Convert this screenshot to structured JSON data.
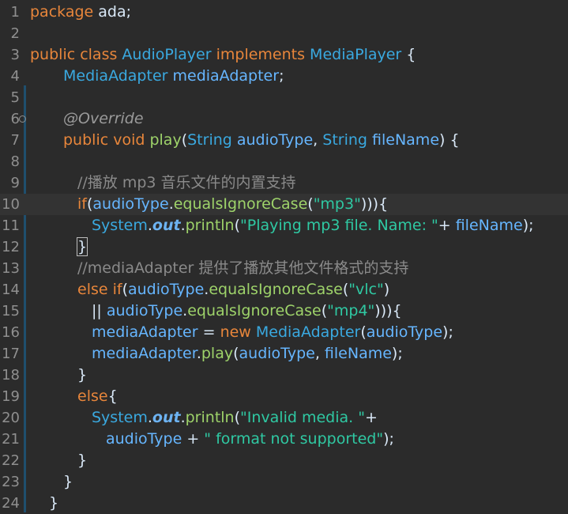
{
  "editor": {
    "current_line": 10,
    "lines": [
      {
        "n": "1",
        "indent": 0,
        "tokens": [
          [
            "kw",
            "package"
          ],
          [
            "pln",
            " ada;"
          ]
        ]
      },
      {
        "n": "2",
        "indent": 0,
        "tokens": []
      },
      {
        "n": "3",
        "indent": 0,
        "tokens": [
          [
            "kw",
            "public class "
          ],
          [
            "type",
            "AudioPlayer"
          ],
          [
            "kw",
            " implements "
          ],
          [
            "type",
            "MediaPlayer"
          ],
          [
            "pln",
            " {"
          ]
        ]
      },
      {
        "n": "4",
        "indent": 42,
        "tokens": [
          [
            "type",
            "MediaAdapter"
          ],
          [
            "pln",
            " "
          ],
          [
            "fld",
            "mediaAdapter"
          ],
          [
            "pln",
            ";"
          ]
        ]
      },
      {
        "n": "5",
        "indent": 0,
        "tokens": []
      },
      {
        "n": "6",
        "indent": 42,
        "tokens": [
          [
            "ann",
            "@Override"
          ]
        ]
      },
      {
        "n": "7",
        "indent": 42,
        "tokens": [
          [
            "kw",
            "public void "
          ],
          [
            "mth",
            "play"
          ],
          [
            "pln",
            "("
          ],
          [
            "type",
            "String"
          ],
          [
            "pln",
            " "
          ],
          [
            "fld",
            "audioType"
          ],
          [
            "pln",
            ", "
          ],
          [
            "type",
            "String"
          ],
          [
            "pln",
            " "
          ],
          [
            "fld",
            "fileName"
          ],
          [
            "pln",
            ") {"
          ]
        ]
      },
      {
        "n": "8",
        "indent": 0,
        "tokens": []
      },
      {
        "n": "9",
        "indent": 60,
        "tokens": [
          [
            "cmt",
            "//播放 mp3 音乐文件的内置支持"
          ]
        ]
      },
      {
        "n": "10",
        "indent": 60,
        "tokens": [
          [
            "kw",
            "if"
          ],
          [
            "pln",
            "("
          ],
          [
            "fld",
            "audioType"
          ],
          [
            "pln",
            "."
          ],
          [
            "mth",
            "equalsIgnoreCase"
          ],
          [
            "pln",
            "("
          ],
          [
            "str",
            "\"mp3\""
          ],
          [
            "pln",
            "))){"
          ]
        ]
      },
      {
        "n": "11",
        "indent": 78,
        "tokens": [
          [
            "type",
            "System"
          ],
          [
            "pln",
            "."
          ],
          [
            "sfield",
            "out"
          ],
          [
            "pln",
            "."
          ],
          [
            "mth",
            "println"
          ],
          [
            "pln",
            "("
          ],
          [
            "str",
            "\"Playing mp3 file. Name: \""
          ],
          [
            "pln",
            "+ "
          ],
          [
            "fld",
            "fileName"
          ],
          [
            "pln",
            ");"
          ]
        ]
      },
      {
        "n": "12",
        "indent": 60,
        "tokens": [
          [
            "brace",
            "}"
          ]
        ]
      },
      {
        "n": "13",
        "indent": 60,
        "tokens": [
          [
            "cmt",
            "//mediaAdapter 提供了播放其他文件格式的支持"
          ]
        ]
      },
      {
        "n": "14",
        "indent": 60,
        "tokens": [
          [
            "kw",
            "else if"
          ],
          [
            "pln",
            "("
          ],
          [
            "fld",
            "audioType"
          ],
          [
            "pln",
            "."
          ],
          [
            "mth",
            "equalsIgnoreCase"
          ],
          [
            "pln",
            "("
          ],
          [
            "str",
            "\"vlc\""
          ],
          [
            "pln",
            ")"
          ]
        ]
      },
      {
        "n": "15",
        "indent": 78,
        "tokens": [
          [
            "pln",
            "|| "
          ],
          [
            "fld",
            "audioType"
          ],
          [
            "pln",
            "."
          ],
          [
            "mth",
            "equalsIgnoreCase"
          ],
          [
            "pln",
            "("
          ],
          [
            "str",
            "\"mp4\""
          ],
          [
            "pln",
            "))){"
          ]
        ]
      },
      {
        "n": "16",
        "indent": 78,
        "tokens": [
          [
            "fld",
            "mediaAdapter"
          ],
          [
            "pln",
            " = "
          ],
          [
            "kw",
            "new "
          ],
          [
            "type",
            "MediaAdapter"
          ],
          [
            "pln",
            "("
          ],
          [
            "fld",
            "audioType"
          ],
          [
            "pln",
            ");"
          ]
        ]
      },
      {
        "n": "17",
        "indent": 78,
        "tokens": [
          [
            "fld",
            "mediaAdapter"
          ],
          [
            "pln",
            "."
          ],
          [
            "mth",
            "play"
          ],
          [
            "pln",
            "("
          ],
          [
            "fld",
            "audioType"
          ],
          [
            "pln",
            ", "
          ],
          [
            "fld",
            "fileName"
          ],
          [
            "pln",
            ");"
          ]
        ]
      },
      {
        "n": "18",
        "indent": 60,
        "tokens": [
          [
            "pln",
            "}"
          ]
        ]
      },
      {
        "n": "19",
        "indent": 60,
        "tokens": [
          [
            "kw",
            "else"
          ],
          [
            "pln",
            "{"
          ]
        ]
      },
      {
        "n": "20",
        "indent": 78,
        "tokens": [
          [
            "type",
            "System"
          ],
          [
            "pln",
            "."
          ],
          [
            "sfield",
            "out"
          ],
          [
            "pln",
            "."
          ],
          [
            "mth",
            "println"
          ],
          [
            "pln",
            "("
          ],
          [
            "str",
            "\"Invalid media. \""
          ],
          [
            "pln",
            "+"
          ]
        ]
      },
      {
        "n": "21",
        "indent": 96,
        "tokens": [
          [
            "fld",
            "audioType"
          ],
          [
            "pln",
            " + "
          ],
          [
            "str",
            "\" format not supported\""
          ],
          [
            "pln",
            ");"
          ]
        ]
      },
      {
        "n": "22",
        "indent": 60,
        "tokens": [
          [
            "pln",
            "}"
          ]
        ]
      },
      {
        "n": "23",
        "indent": 42,
        "tokens": [
          [
            "pln",
            "}"
          ]
        ]
      },
      {
        "n": "24",
        "indent": 24,
        "tokens": [
          [
            "pln",
            "}"
          ]
        ]
      }
    ]
  },
  "colors": {
    "background": "#2b2b2b",
    "keyword": "#e8863b",
    "type": "#3aa9e0",
    "field": "#66b6ff",
    "method": "#9ed36a",
    "string": "#2fc9a3",
    "comment": "#8a8a8a",
    "current_line": "#333333"
  }
}
